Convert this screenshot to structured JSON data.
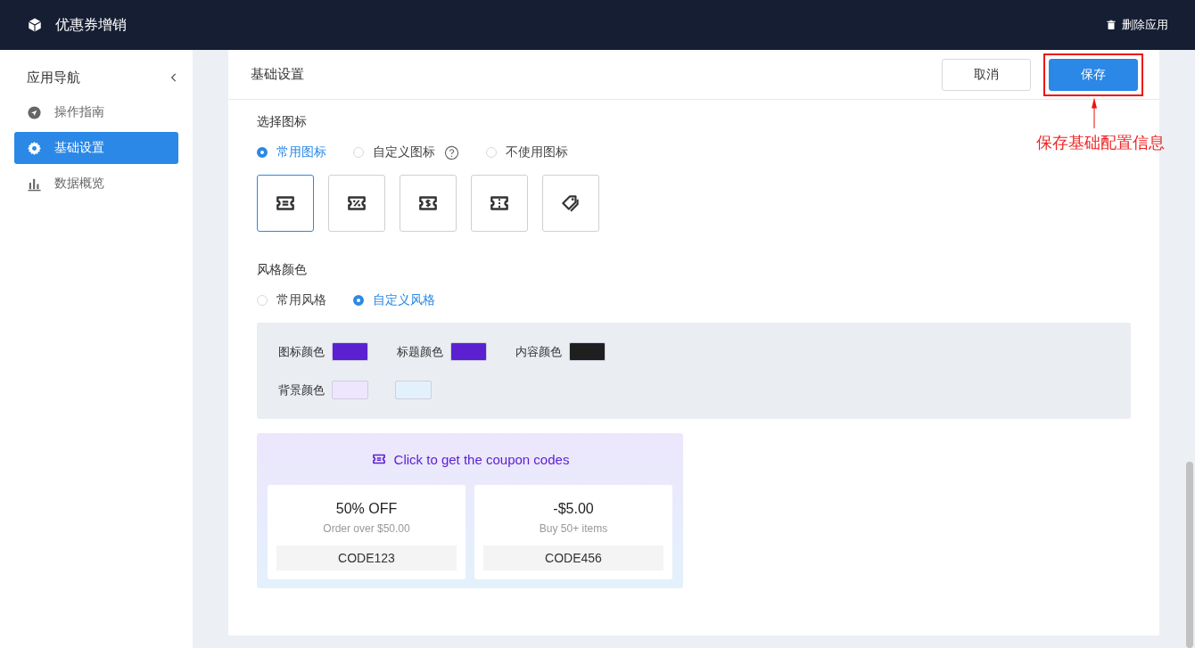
{
  "app": {
    "title": "优惠券增销",
    "delete_label": "删除应用"
  },
  "sidebar": {
    "title": "应用导航",
    "items": [
      {
        "label": "操作指南",
        "kind": "guide",
        "selected": false
      },
      {
        "label": "基础设置",
        "kind": "settings",
        "selected": true
      },
      {
        "label": "数据概览",
        "kind": "chart",
        "selected": false
      }
    ]
  },
  "page": {
    "title": "基础设置",
    "buttons": [
      {
        "label": "取消",
        "kind": "default"
      },
      {
        "label": "保存",
        "kind": "primary"
      }
    ],
    "annotation": "保存基础配置信息"
  },
  "icon_section": {
    "label": "选择图标",
    "options": [
      {
        "label": "常用图标",
        "selected": true,
        "help": false
      },
      {
        "label": "自定义图标",
        "selected": false,
        "help": true
      },
      {
        "label": "不使用图标",
        "selected": false,
        "help": false
      }
    ],
    "icons": [
      {
        "kind": "ticket",
        "selected": true
      },
      {
        "kind": "percent",
        "selected": false
      },
      {
        "kind": "dollar",
        "selected": false
      },
      {
        "kind": "perforated",
        "selected": false
      },
      {
        "kind": "tags",
        "selected": false
      }
    ]
  },
  "style_section": {
    "label": "风格颜色",
    "options": [
      {
        "label": "常用风格",
        "selected": false
      },
      {
        "label": "自定义风格",
        "selected": true
      }
    ],
    "rows": [
      {
        "items": [
          {
            "label": "图标颜色",
            "swatches": [
              {
                "color": "#5b21d1"
              }
            ]
          },
          {
            "label": "标题颜色",
            "swatches": [
              {
                "color": "#5b21d1"
              }
            ]
          },
          {
            "label": "内容颜色",
            "swatches": [
              {
                "color": "#1f1f1f"
              }
            ]
          }
        ]
      },
      {
        "items": [
          {
            "label": "背景颜色",
            "swatches": [
              {
                "color": "#ede6fc"
              },
              {
                "color": "#e3f1fc"
              }
            ]
          }
        ]
      }
    ]
  },
  "preview": {
    "header": "Click to get the coupon codes",
    "coupons": [
      {
        "title": "50% OFF",
        "subtitle": "Order over $50.00",
        "code": "CODE123"
      },
      {
        "title": "-$5.00",
        "subtitle": "Buy 50+ items",
        "code": "CODE456"
      }
    ]
  }
}
